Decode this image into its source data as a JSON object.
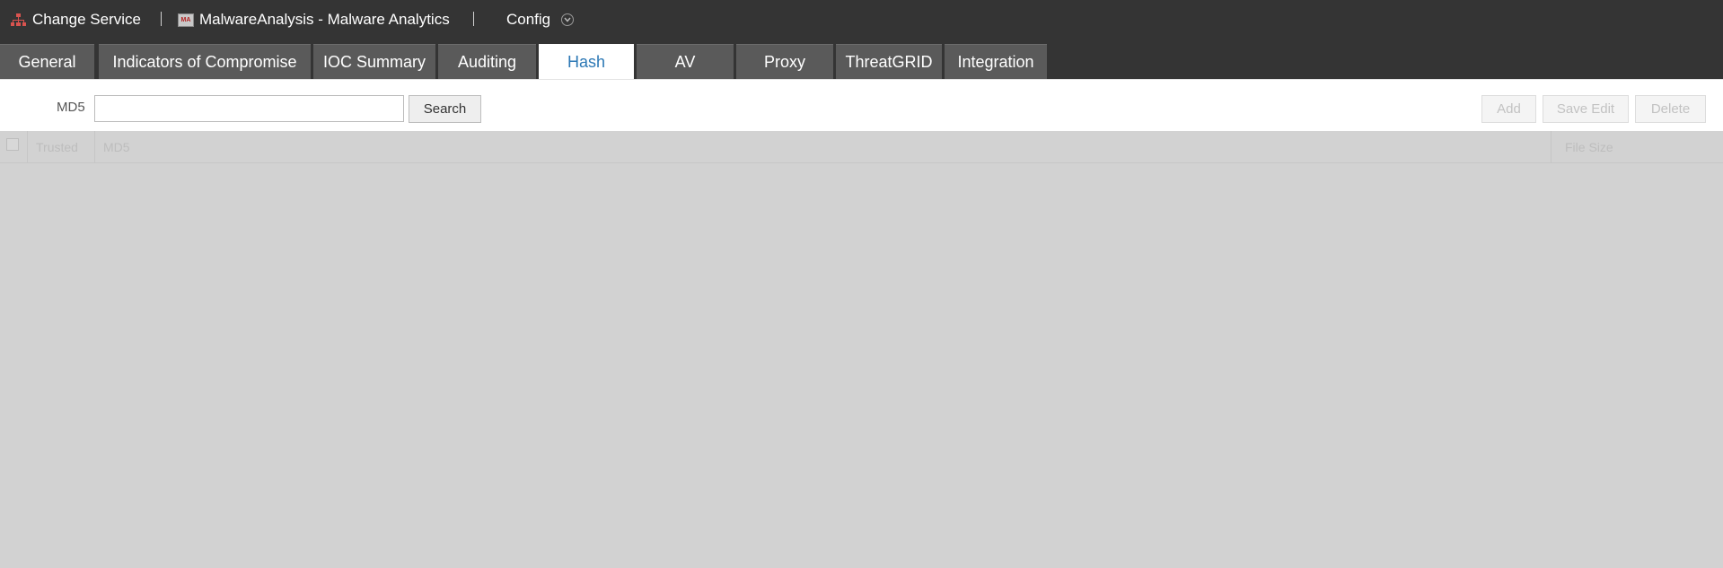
{
  "header": {
    "change_service": "Change Service",
    "service_name": "MalwareAnalysis - Malware Analytics",
    "service_icon_text": "MA",
    "config": "Config",
    "icons": [
      "network-icon",
      "malware-analysis-icon",
      "chevron-down-icon"
    ]
  },
  "tabs": [
    {
      "label": "General",
      "active": false
    },
    {
      "label": "Indicators of Compromise",
      "active": false
    },
    {
      "label": "IOC Summary",
      "active": false
    },
    {
      "label": "Auditing",
      "active": false
    },
    {
      "label": "Hash",
      "active": true
    },
    {
      "label": "AV",
      "active": false
    },
    {
      "label": "Proxy",
      "active": false
    },
    {
      "label": "ThreatGRID",
      "active": false
    },
    {
      "label": "Integration",
      "active": false
    }
  ],
  "toolbar": {
    "md5_label": "MD5",
    "md5_value": "",
    "md5_placeholder": "",
    "search_label": "Search",
    "add_label": "Add",
    "save_edit_label": "Save Edit",
    "delete_label": "Delete"
  },
  "grid": {
    "columns": [
      "Trusted",
      "MD5",
      "File Size"
    ],
    "rows": []
  },
  "colors": {
    "header_bg": "#343434",
    "tab_bg": "#5a5a5a",
    "active_tab_text": "#2c78b5",
    "grid_bg": "#d2d2d2"
  }
}
